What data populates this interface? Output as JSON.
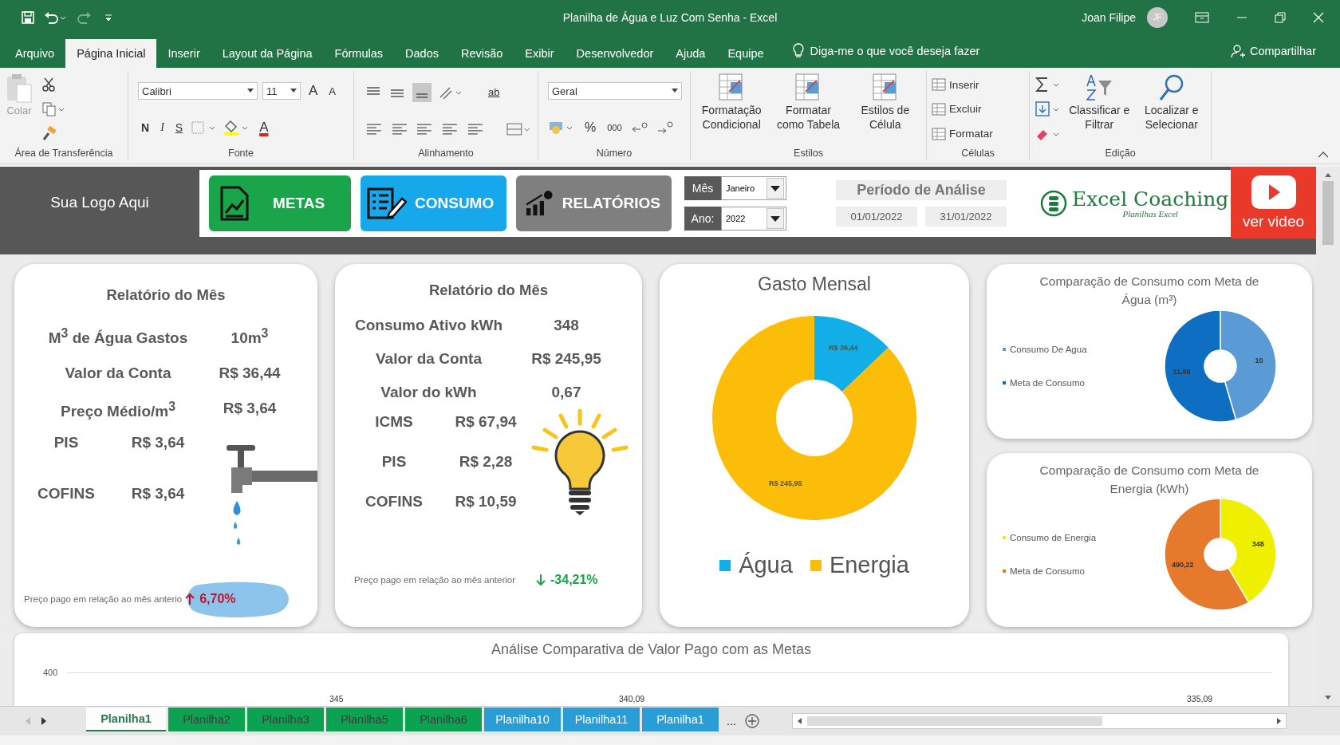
{
  "window": {
    "title": "Planilha de Água e Luz Com Senha  -  Excel",
    "user": "Joan Filipe",
    "avatar": "JF"
  },
  "menu_tabs": [
    {
      "label": "Arquivo",
      "selected": false
    },
    {
      "label": "Página Inicial",
      "selected": true
    },
    {
      "label": "Inserir",
      "selected": false
    },
    {
      "label": "Layout da Página",
      "selected": false
    },
    {
      "label": "Fórmulas",
      "selected": false
    },
    {
      "label": "Dados",
      "selected": false
    },
    {
      "label": "Revisão",
      "selected": false
    },
    {
      "label": "Exibir",
      "selected": false
    },
    {
      "label": "Desenvolvedor",
      "selected": false
    },
    {
      "label": "Ajuda",
      "selected": false
    },
    {
      "label": "Equipe",
      "selected": false
    }
  ],
  "tell_me": "Diga-me o que você deseja fazer",
  "share": "Compartilhar",
  "ribbon": {
    "clipboard": {
      "paste": "Colar",
      "group": "Área de Transferência"
    },
    "font": {
      "family": "Calibri",
      "size": "11",
      "grow": "A",
      "shrink": "A",
      "bold": "N",
      "italic": "I",
      "underline": "S",
      "text_tool": "A",
      "group": "Fonte"
    },
    "alignment": {
      "wrap": "ab",
      "group": "Alinhamento"
    },
    "number": {
      "format": "Geral",
      "percent": "%",
      "thousands": "000",
      "group": "Número"
    },
    "styles": {
      "buttons": [
        "Formatação Condicional",
        "Formatar como Tabela",
        "Estilos de Célula"
      ],
      "group": "Estilos"
    },
    "cells": {
      "buttons": [
        "Inserir",
        "Excluir",
        "Formatar"
      ],
      "group": "Células"
    },
    "editing": {
      "buttons": [
        "Classificar e Filtrar",
        "Localizar e Selecionar"
      ],
      "group": "Edição"
    }
  },
  "header": {
    "logo": "Sua Logo Aqui",
    "nav": [
      {
        "label": "METAS",
        "color": "#1aa54b"
      },
      {
        "label": "CONSUMO",
        "color": "#17a8eb"
      },
      {
        "label": "RELATÓRIOS",
        "color": "#7f7f7f"
      }
    ],
    "month": {
      "label": "Mês",
      "value": "Janeiro"
    },
    "year": {
      "label": "Ano:",
      "value": "2022"
    },
    "period": {
      "title": "Período de Análise",
      "start": "01/01/2022",
      "end": "31/01/2022"
    },
    "brand": {
      "name": "Excel Coaching",
      "tagline": "Planilhas Excel"
    },
    "video": "ver video"
  },
  "water_card": {
    "title": "Relatório do Mês",
    "rows": [
      {
        "label": "M$^{3}$ de Água Gastos",
        "value": "10m$^{3}$"
      },
      {
        "label": "Valor da Conta",
        "value": "R$ 36,44"
      },
      {
        "label": "Preço Médio/m$^{3}$",
        "value": "R$ 3,64"
      }
    ],
    "tax_rows": [
      {
        "label": "PIS",
        "value": "R$ 3,64"
      },
      {
        "label": "COFINS",
        "value": "R$ 3,64"
      }
    ],
    "footnote": "Preço pago em relação ao mês anterio",
    "change": "6,70%",
    "rising": true
  },
  "energy_card": {
    "title": "Relatório do Mês",
    "rows": [
      {
        "label": "Consumo Ativo kWh",
        "value": "348"
      },
      {
        "label": "Valor da Conta",
        "value": "R$ 245,95"
      },
      {
        "label": "Valor do kWh",
        "value": "0,67"
      }
    ],
    "tax_rows": [
      {
        "label": "ICMS",
        "value": "R$ 67,94"
      },
      {
        "label": "PIS",
        "value": "R$ 2,28"
      },
      {
        "label": "COFINS",
        "value": "R$ 10,59"
      }
    ],
    "footnote": "Preço pago em relação ao mês anterior",
    "change": "-34,21%",
    "rising": false
  },
  "monthly_chart": {
    "chart_data": {
      "type": "donut",
      "title": "Gasto Mensal",
      "categories": [
        "Água",
        "Energia"
      ],
      "colors": [
        "#12aee8",
        "#fbbd08"
      ],
      "legend": "bottom",
      "value_labels": [
        "R$ 36,44",
        "R$ 245,95"
      ],
      "series": [
        {
          "values": [
            12.9,
            87.1
          ]
        }
      ]
    }
  },
  "water_goal_chart": {
    "chart_data": {
      "type": "donut",
      "title": "Comparação de Consumo com Meta de Água (m³)",
      "categories": [
        "Consumo De Agua",
        "Meta de Consumo"
      ],
      "colors": [
        "#5b9bd5",
        "#0e6fc2"
      ],
      "legend": "left",
      "value_labels": [
        "10",
        "11,98"
      ],
      "series": [
        {
          "values": [
            45.5,
            54.5
          ]
        }
      ]
    }
  },
  "energy_goal_chart": {
    "chart_data": {
      "type": "donut",
      "title": "Comparação de Consumo com Meta de Energia (kWh)",
      "categories": [
        "Consumo de Energia",
        "Meta de Consumo"
      ],
      "colors": [
        "#eef000",
        "#e67a2c"
      ],
      "legend": "left",
      "value_labels": [
        "348",
        "490,22"
      ],
      "series": [
        {
          "values": [
            41.52,
            58.48
          ]
        }
      ]
    }
  },
  "comparison_chart": {
    "title": "Análise Comparativa de Valor Pago com as Metas",
    "axis_label": "400",
    "point_labels": [
      "345",
      "340,09",
      "335,09"
    ]
  },
  "sheet_tabs": [
    {
      "label": "Planilha1",
      "selected": true,
      "color": "#ffffff"
    },
    {
      "label": "Planilha2",
      "selected": false,
      "color": "#00a04b"
    },
    {
      "label": "Planilha3",
      "selected": false,
      "color": "#00a04b"
    },
    {
      "label": "Planilha5",
      "selected": false,
      "color": "#00a04b"
    },
    {
      "label": "Planilha6",
      "selected": false,
      "color": "#00a04b"
    },
    {
      "label": "Planilha10",
      "selected": false,
      "color": "#1e9ad6"
    },
    {
      "label": "Planilha11",
      "selected": false,
      "color": "#1e9ad6"
    },
    {
      "label": "Planilha1",
      "selected": false,
      "color": "#1e9ad6"
    }
  ],
  "more_tabs": "..."
}
